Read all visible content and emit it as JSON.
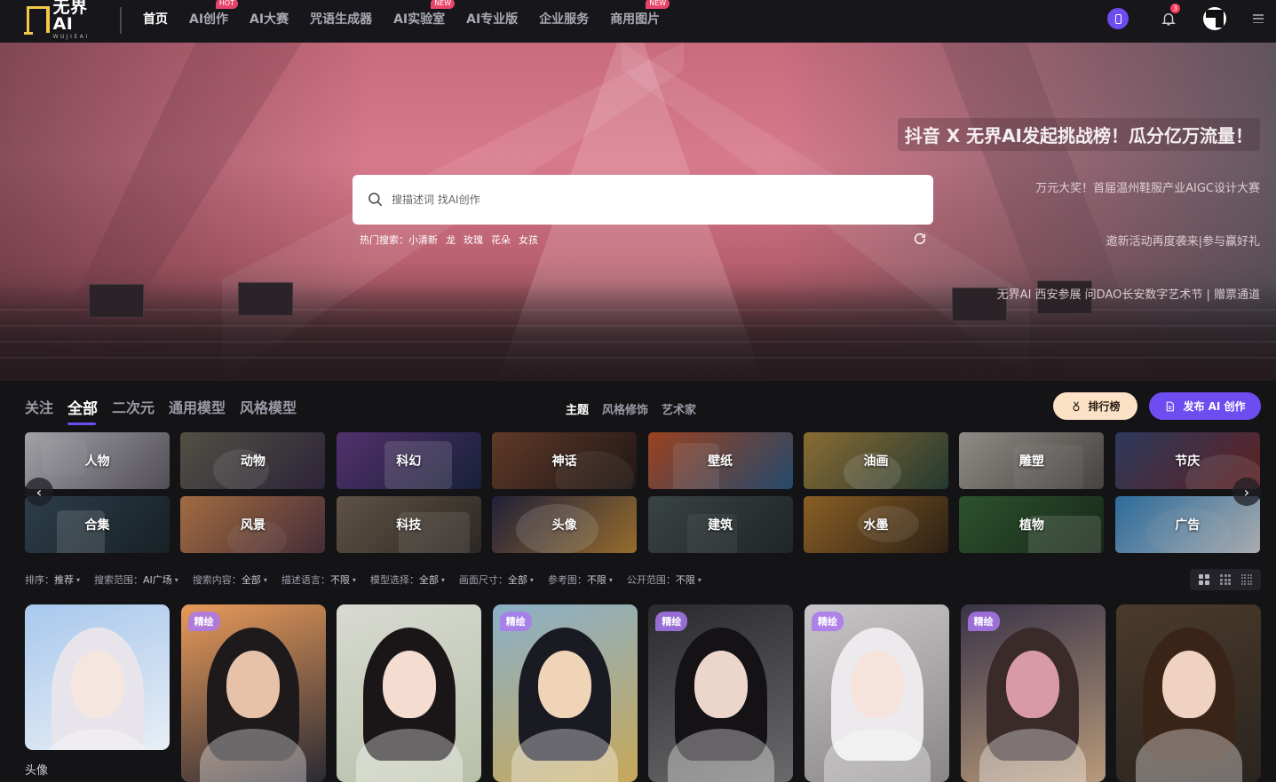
{
  "nav": {
    "logo_main": "无界AI",
    "logo_sub": "WUJIEAI",
    "items": [
      {
        "label": "首页",
        "badge": ""
      },
      {
        "label": "AI创作",
        "badge": "HOT"
      },
      {
        "label": "AI大赛",
        "badge": ""
      },
      {
        "label": "咒语生成器",
        "badge": ""
      },
      {
        "label": "AI实验室",
        "badge": "NEW"
      },
      {
        "label": "AI专业版",
        "badge": ""
      },
      {
        "label": "企业服务",
        "badge": ""
      },
      {
        "label": "商用图片",
        "badge": "NEW"
      }
    ],
    "notification_count": "3",
    "accent": "#6d4cf0"
  },
  "hero": {
    "promo_main": "抖音 X 无界AI发起挑战榜！瓜分亿万流量！",
    "promo_items": [
      "万元大奖！首届温州鞋服产业AIGC设计大赛",
      "邀新活动再度袭来|参与赢好礼",
      "无界AI 西安参展 问DAO长安数字艺术节 | 赠票通道"
    ],
    "search_placeholder": "搜描述词 找AI创作",
    "hot_label": "热门搜索：",
    "hot_tags": [
      "小清新",
      "龙",
      "玫瑰",
      "花朵",
      "女孩"
    ]
  },
  "tabs": {
    "main": [
      "关注",
      "全部",
      "二次元",
      "通用模型",
      "风格模型"
    ],
    "active_main": "全部",
    "sub": [
      "主题",
      "风格修饰",
      "艺术家"
    ],
    "active_sub": "主题",
    "rank_label": "排行榜",
    "publish_label": "发布 AI 创作"
  },
  "categories": [
    {
      "label": "人物",
      "c1": "#cfcfd6",
      "c2": "#6a6470",
      "icon": "portrait-image"
    },
    {
      "label": "动物",
      "c1": "#6a6658",
      "c2": "#3a2f48",
      "icon": "animal-image"
    },
    {
      "label": "科幻",
      "c1": "#6a3f8a",
      "c2": "#1f2a4a",
      "icon": "scifi-image"
    },
    {
      "label": "神话",
      "c1": "#7a4a34",
      "c2": "#2a1d1a",
      "icon": "myth-image"
    },
    {
      "label": "壁纸",
      "c1": "#c8542a",
      "c2": "#2f5f8a",
      "icon": "wallpaper-image"
    },
    {
      "label": "油画",
      "c1": "#b08a40",
      "c2": "#2f4a3f",
      "icon": "oilpaint-image"
    },
    {
      "label": "雕塑",
      "c1": "#b8b2ac",
      "c2": "#5a5652",
      "icon": "sculpture-image"
    },
    {
      "label": "节庆",
      "c1": "#3a4a78",
      "c2": "#7a2a2a",
      "icon": "festival-image"
    },
    {
      "label": "合集",
      "c1": "#3a5060",
      "c2": "#1e2a30",
      "icon": "collection-image"
    },
    {
      "label": "风景",
      "c1": "#d08a52",
      "c2": "#5a3a4a",
      "icon": "landscape-image"
    },
    {
      "label": "科技",
      "c1": "#7a6a58",
      "c2": "#3a3430",
      "icon": "tech-image"
    },
    {
      "label": "头像",
      "c1": "#2a2a4a",
      "c2": "#c08a3a",
      "icon": "avatar-image"
    },
    {
      "label": "建筑",
      "c1": "#4a5658",
      "c2": "#2a3032",
      "icon": "building-image"
    },
    {
      "label": "水墨",
      "c1": "#b07a30",
      "c2": "#3a2a1a",
      "icon": "ink-image"
    },
    {
      "label": "植物",
      "c1": "#3a6a3a",
      "c2": "#1e3420",
      "icon": "plant-image"
    },
    {
      "label": "广告",
      "c1": "#3a8ac8",
      "c2": "#d8dce0",
      "icon": "ad-image"
    }
  ],
  "filters": [
    {
      "label": "排序：",
      "value": "推荐"
    },
    {
      "label": "搜索范围：",
      "value": "AI广场"
    },
    {
      "label": "搜索内容：",
      "value": "全部"
    },
    {
      "label": "描述语言：",
      "value": "不限"
    },
    {
      "label": "模型选择：",
      "value": "全部"
    },
    {
      "label": "画面尺寸：",
      "value": "全部"
    },
    {
      "label": "参考图：",
      "value": "不限"
    },
    {
      "label": "公开范围：",
      "value": "不限"
    }
  ],
  "gallery": [
    {
      "badge": "",
      "caption": "头像",
      "bg1": "#a8c8ec",
      "bg2": "#e8eef6",
      "hair": "#e8e4ec",
      "skin": "#f6e6e0"
    },
    {
      "badge": "精绘",
      "caption": "",
      "bg1": "#e89a5a",
      "bg2": "#2a2a34",
      "hair": "#1e1a1c",
      "skin": "#e8c2a8"
    },
    {
      "badge": "",
      "caption": "",
      "bg1": "#d8dad2",
      "bg2": "#b8c0a8",
      "hair": "#1a1618",
      "skin": "#f4dcd0"
    },
    {
      "badge": "精绘",
      "caption": "",
      "bg1": "#8ab0c8",
      "bg2": "#c8a85a",
      "hair": "#1a1a22",
      "skin": "#f0d4b8"
    },
    {
      "badge": "精绘",
      "caption": "",
      "bg1": "#2a2a2c",
      "bg2": "#6a6a6c",
      "hair": "#141214",
      "skin": "#ecd6cc"
    },
    {
      "badge": "精绘",
      "caption": "",
      "bg1": "#c8c6c8",
      "bg2": "#8a8688",
      "hair": "#eceaec",
      "skin": "#f6e4dc"
    },
    {
      "badge": "精绘",
      "caption": "",
      "bg1": "#3a3448",
      "bg2": "#b89a7a",
      "hair": "#3a2a2a",
      "skin": "#d89aa8"
    },
    {
      "badge": "",
      "caption": "",
      "bg1": "#4a3a2a",
      "bg2": "#2a2420",
      "hair": "#3a2418",
      "skin": "#f0d2c2"
    }
  ]
}
